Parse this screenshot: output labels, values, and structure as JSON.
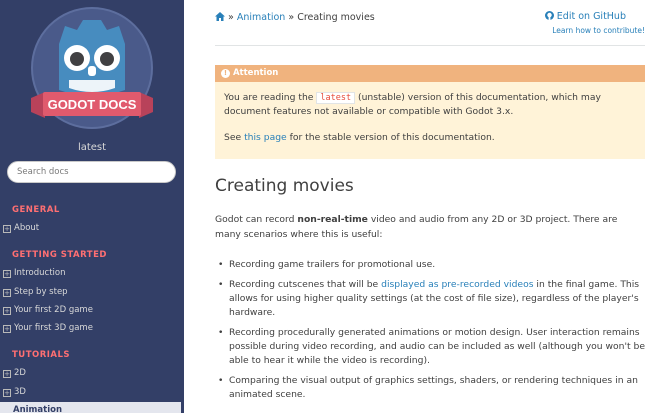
{
  "sidebar": {
    "logo_text": "GODOT DOCS",
    "version": "latest",
    "search_placeholder": "Search docs",
    "sections": [
      {
        "caption": "GENERAL",
        "items": [
          {
            "label": "About"
          }
        ]
      },
      {
        "caption": "GETTING STARTED",
        "items": [
          {
            "label": "Introduction"
          },
          {
            "label": "Step by step"
          },
          {
            "label": "Your first 2D game"
          },
          {
            "label": "Your first 3D game"
          }
        ]
      },
      {
        "caption": "TUTORIALS",
        "items": [
          {
            "label": "2D"
          },
          {
            "label": "3D"
          },
          {
            "label": "Animation"
          }
        ]
      }
    ]
  },
  "breadcrumb": {
    "sep1": "»",
    "item1": "Animation",
    "sep2": "»",
    "current": "Creating movies"
  },
  "github": {
    "edit": "Edit on GitHub",
    "learn": "Learn how to contribute!"
  },
  "admonition": {
    "title": "Attention",
    "p1_a": "You are reading the ",
    "p1_code": "latest",
    "p1_b": " (unstable) version of this documentation, which may document features not available or compatible with Godot 3.x.",
    "p2_a": "See ",
    "p2_link": "this page",
    "p2_b": " for the stable version of this documentation."
  },
  "page": {
    "title": "Creating movies",
    "intro_a": "Godot can record ",
    "intro_bold": "non-real-time",
    "intro_b": " video and audio from any 2D or 3D project. There are many scenarios where this is useful:",
    "bullets": [
      {
        "text": "Recording game trailers for promotional use."
      },
      {
        "a": "Recording cutscenes that will be ",
        "link": "displayed as pre-recorded videos",
        "b": " in the final game. This allows for using higher quality settings (at the cost of file size), regardless of the player's hardware."
      },
      {
        "text": "Recording procedurally generated animations or motion design. User interaction remains possible during video recording, and audio can be included as well (although you won't be able to hear it while the video is recording)."
      },
      {
        "text": "Comparing the visual output of graphics settings, shaders, or rendering techniques in an animated scene."
      }
    ]
  },
  "colors": {
    "sidebar_bg": "#333f67",
    "accent": "#2980b9",
    "caption": "#ff6f72",
    "attention": "#f0b37e",
    "logo_blue": "#478cbf",
    "ribbon": "#e05a6d"
  }
}
